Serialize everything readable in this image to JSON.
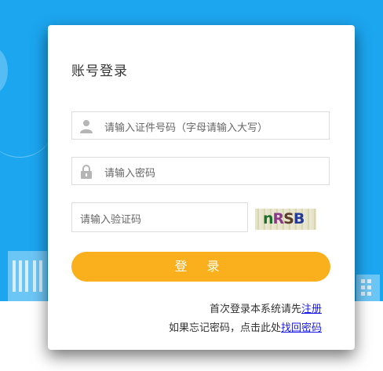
{
  "login": {
    "title": "账号登录",
    "id_placeholder": "请输入证件号码（字母请输入大写）",
    "password_placeholder": "请输入密码",
    "captcha_placeholder": "请输入验证码",
    "captcha_text": "nRSB",
    "login_label": "登 录",
    "register_prompt": "首次登录本系统请先",
    "register_link": "注册",
    "recover_prompt": "如果忘记密码，点击此处",
    "recover_link": "找回密码"
  },
  "icons": {
    "user": "user-icon",
    "lock": "lock-icon"
  },
  "colors": {
    "background": "#1ca6f0",
    "button": "#f9b01c",
    "link": "#1a1ae6",
    "captcha_letters": [
      "#1b6e2b",
      "#8a3a8a",
      "#5a3a2a",
      "#223a9a"
    ]
  }
}
